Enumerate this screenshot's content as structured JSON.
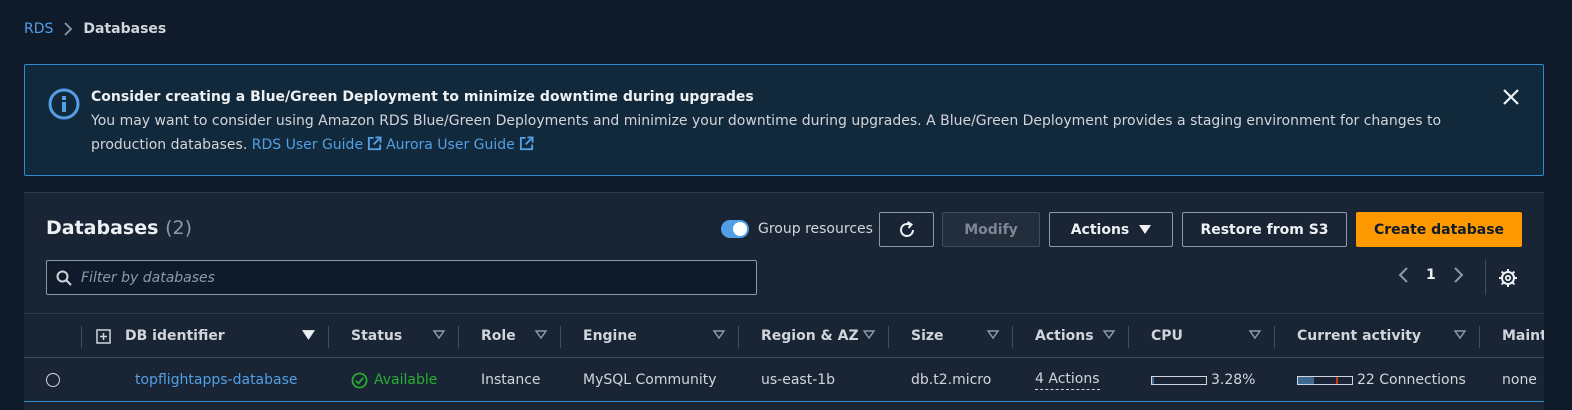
{
  "breadcrumb": {
    "root": "RDS",
    "current": "Databases"
  },
  "banner": {
    "title": "Consider creating a Blue/Green Deployment to minimize downtime during upgrades",
    "body_line1": "You may want to consider using Amazon RDS Blue/Green Deployments and minimize your downtime during upgrades. A Blue/Green Deployment provides a staging environment for changes to",
    "body_line2": "production databases.",
    "link1": "RDS User Guide",
    "link2": "Aurora User Guide"
  },
  "panel": {
    "title": "Databases",
    "count": "(2)",
    "group_toggle_label": "Group resources",
    "group_toggle_on": true,
    "buttons": {
      "modify": "Modify",
      "actions": "Actions",
      "restore": "Restore from S3",
      "create": "Create database"
    },
    "filter_placeholder": "Filter by databases",
    "page": "1"
  },
  "table": {
    "columns": [
      "DB identifier",
      "Status",
      "Role",
      "Engine",
      "Region & AZ",
      "Size",
      "Actions",
      "CPU",
      "Current activity",
      "Maint"
    ],
    "rows": [
      {
        "db_identifier": "topflightapps-database",
        "status": "Available",
        "role": "Instance",
        "engine": "MySQL Community",
        "region": "us-east-1b",
        "size": "db.t2.micro",
        "actions": "4 Actions",
        "cpu": "3.28%",
        "cpu_fraction": 0.0328,
        "activity": "22 Connections",
        "activity_fraction": 0.3,
        "maint": "none"
      }
    ]
  },
  "colors": {
    "accent": "#539fe5",
    "primary_button": "#ff9900",
    "status_available": "#29ad32"
  }
}
